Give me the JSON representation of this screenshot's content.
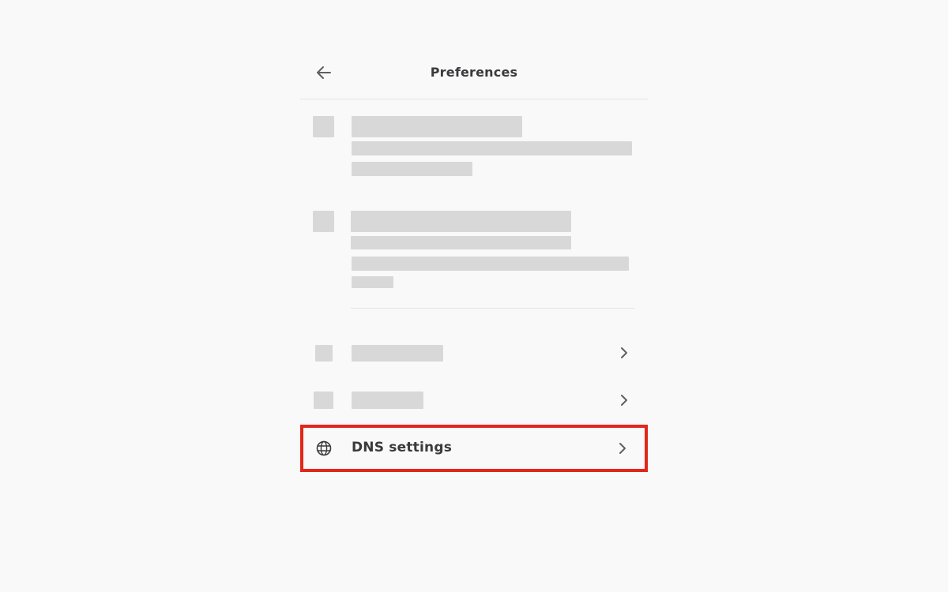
{
  "header": {
    "title": "Preferences",
    "back_icon": "arrow-left-icon"
  },
  "items": {
    "dns": {
      "label": "DNS settings",
      "icon": "globe-icon",
      "trailing_icon": "chevron-right-icon"
    }
  },
  "colors": {
    "background": "#f9f9fa",
    "skeleton": "#d8d8d8",
    "highlight": "#e0271a",
    "text": "#3a3a3c"
  }
}
